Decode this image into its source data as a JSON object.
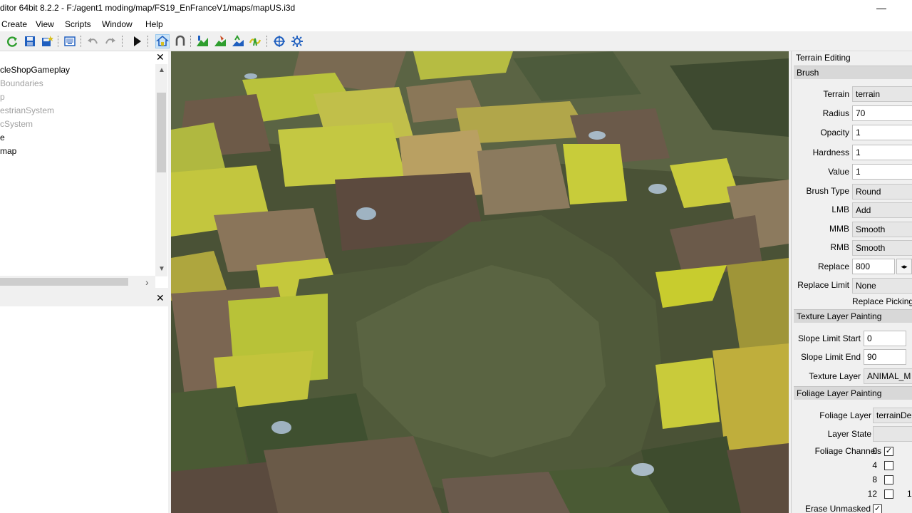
{
  "window": {
    "title": "ditor 64bit 8.2.2 - F:/agent1 moding/map/FS19_EnFranceV1/maps/mapUS.i3d",
    "minimize_glyph": "—"
  },
  "menu": [
    "Create",
    "View",
    "Scripts",
    "Window",
    "Help"
  ],
  "toolbar": {
    "icons": [
      "refresh-icon",
      "save-icon",
      "save-as-icon",
      "import-icon",
      "undo-icon",
      "redo-icon",
      "play-icon",
      "camera-home-icon",
      "magnet-icon",
      "terrain-raise-icon",
      "terrain-paint-icon",
      "foliage-paint-icon",
      "foliage-wave-icon",
      "rotate-icon",
      "settings-gear-icon"
    ],
    "colors": {
      "active_bg": "#cce4f7",
      "green": "#2e9e2e",
      "blue": "#1f5fbf",
      "yellow": "#d8c020"
    }
  },
  "scenegraph": {
    "items": [
      "cleShopGameplay",
      "Boundaries",
      "p",
      "estrianSystem",
      "cSystem",
      "e",
      "map"
    ],
    "dimmed": [
      false,
      true,
      true,
      true,
      true,
      false,
      false
    ],
    "close_glyph": "✕",
    "scroll_up": "▲",
    "scroll_down": "▼",
    "scroll_right": "›"
  },
  "bottom_panel": {
    "close_glyph": "✕"
  },
  "terrain_editing": {
    "title": "Terrain Editing",
    "brush": {
      "header": "Brush",
      "fields": [
        {
          "label": "Terrain",
          "value": "terrain"
        },
        {
          "label": "Radius",
          "value": "70"
        },
        {
          "label": "Opacity",
          "value": "1"
        },
        {
          "label": "Hardness",
          "value": "1"
        },
        {
          "label": "Value",
          "value": "1"
        },
        {
          "label": "Brush Type",
          "value": "Round"
        },
        {
          "label": "LMB",
          "value": "Add"
        },
        {
          "label": "MMB",
          "value": "Smooth"
        },
        {
          "label": "RMB",
          "value": "Smooth"
        },
        {
          "label": "Replace",
          "value": "800"
        },
        {
          "label": "Replace Limit",
          "value": "None"
        }
      ],
      "spin_glyph": "◂▸",
      "replace_picking": "Replace Picking"
    },
    "texture": {
      "header": "Texture Layer Painting",
      "fields": [
        {
          "label": "Slope Limit Start",
          "value": "0"
        },
        {
          "label": "Slope Limit End",
          "value": "90"
        },
        {
          "label": "Texture Layer",
          "value": "ANIMAL_M"
        }
      ]
    },
    "foliage": {
      "header": "Foliage Layer Painting",
      "fields": [
        {
          "label": "Foliage Layer",
          "value": "terrainDe"
        },
        {
          "label": "Layer State",
          "value": ""
        }
      ],
      "channels_label": "Foliage Channels",
      "channels": [
        {
          "num": "0",
          "checked": true
        },
        {
          "num": "4",
          "checked": false
        },
        {
          "num": "8",
          "checked": false
        },
        {
          "num": "12",
          "checked": false
        }
      ],
      "channel_extra": "1",
      "erase_unmasked": {
        "label": "Erase Unmasked",
        "checked": true
      }
    }
  },
  "terrain_colors": {
    "dark_grass": "#465036",
    "field_yellow": "#b8c23a",
    "plowed_brown": "#6a5a48",
    "light_brown": "#8c7658",
    "forest": "#3a4a2e"
  }
}
